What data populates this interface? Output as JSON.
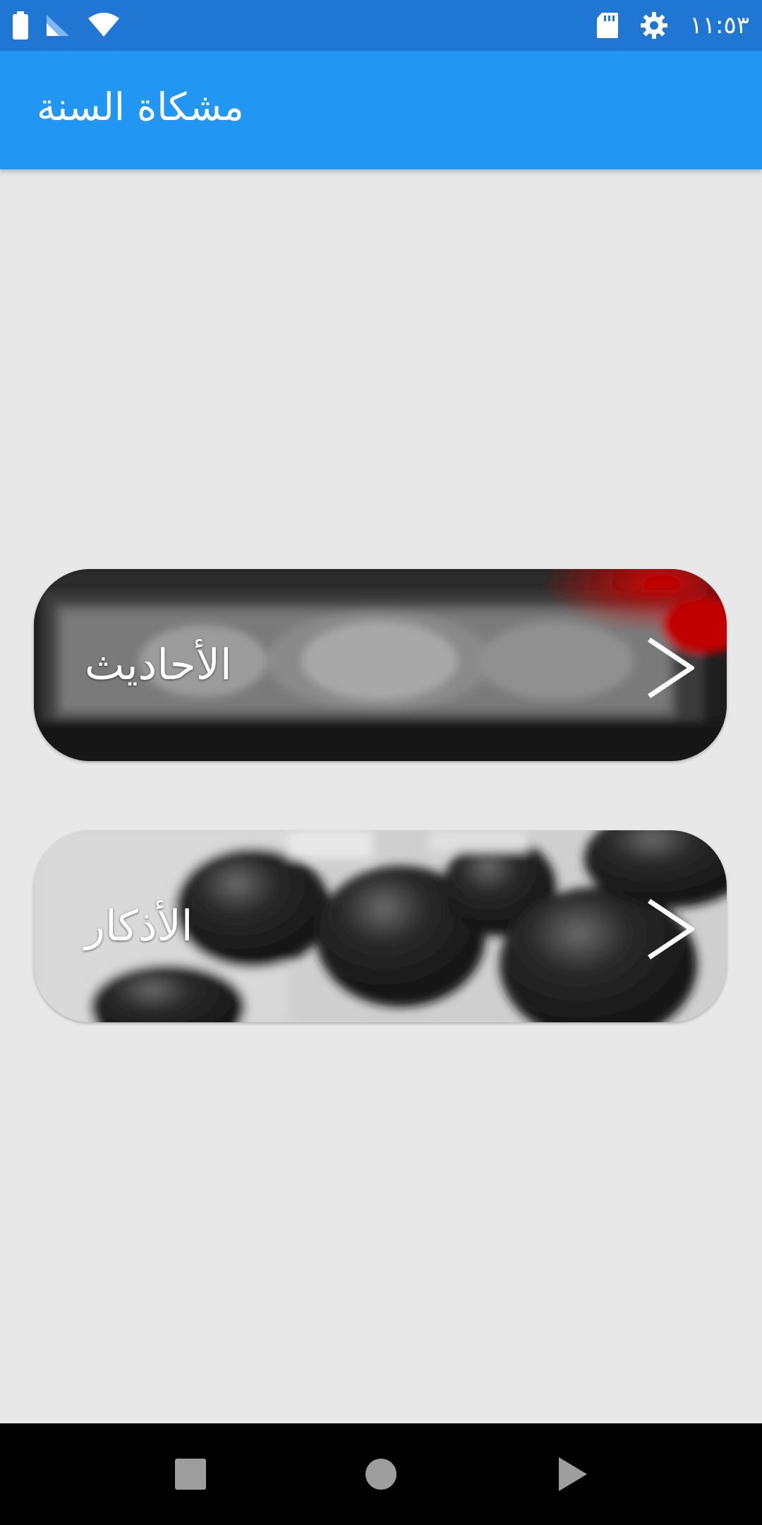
{
  "status_bar": {
    "time": "١١:٥٣",
    "icons": [
      "battery-icon",
      "signal-icon",
      "wifi-icon",
      "sd-card-icon",
      "settings-gear-icon"
    ]
  },
  "app_bar": {
    "title": "مشكاة السنة"
  },
  "cards": [
    {
      "label": "الأحاديث",
      "icon": "chevron-right-icon"
    },
    {
      "label": "الأذكار",
      "icon": "chevron-right-icon"
    }
  ],
  "nav_bar": {
    "buttons": [
      "recents-square-icon",
      "home-circle-icon",
      "back-triangle-icon"
    ]
  },
  "colors": {
    "status_bar": "#1f77d3",
    "app_bar": "#2196f3",
    "background": "#e8e8e8"
  }
}
